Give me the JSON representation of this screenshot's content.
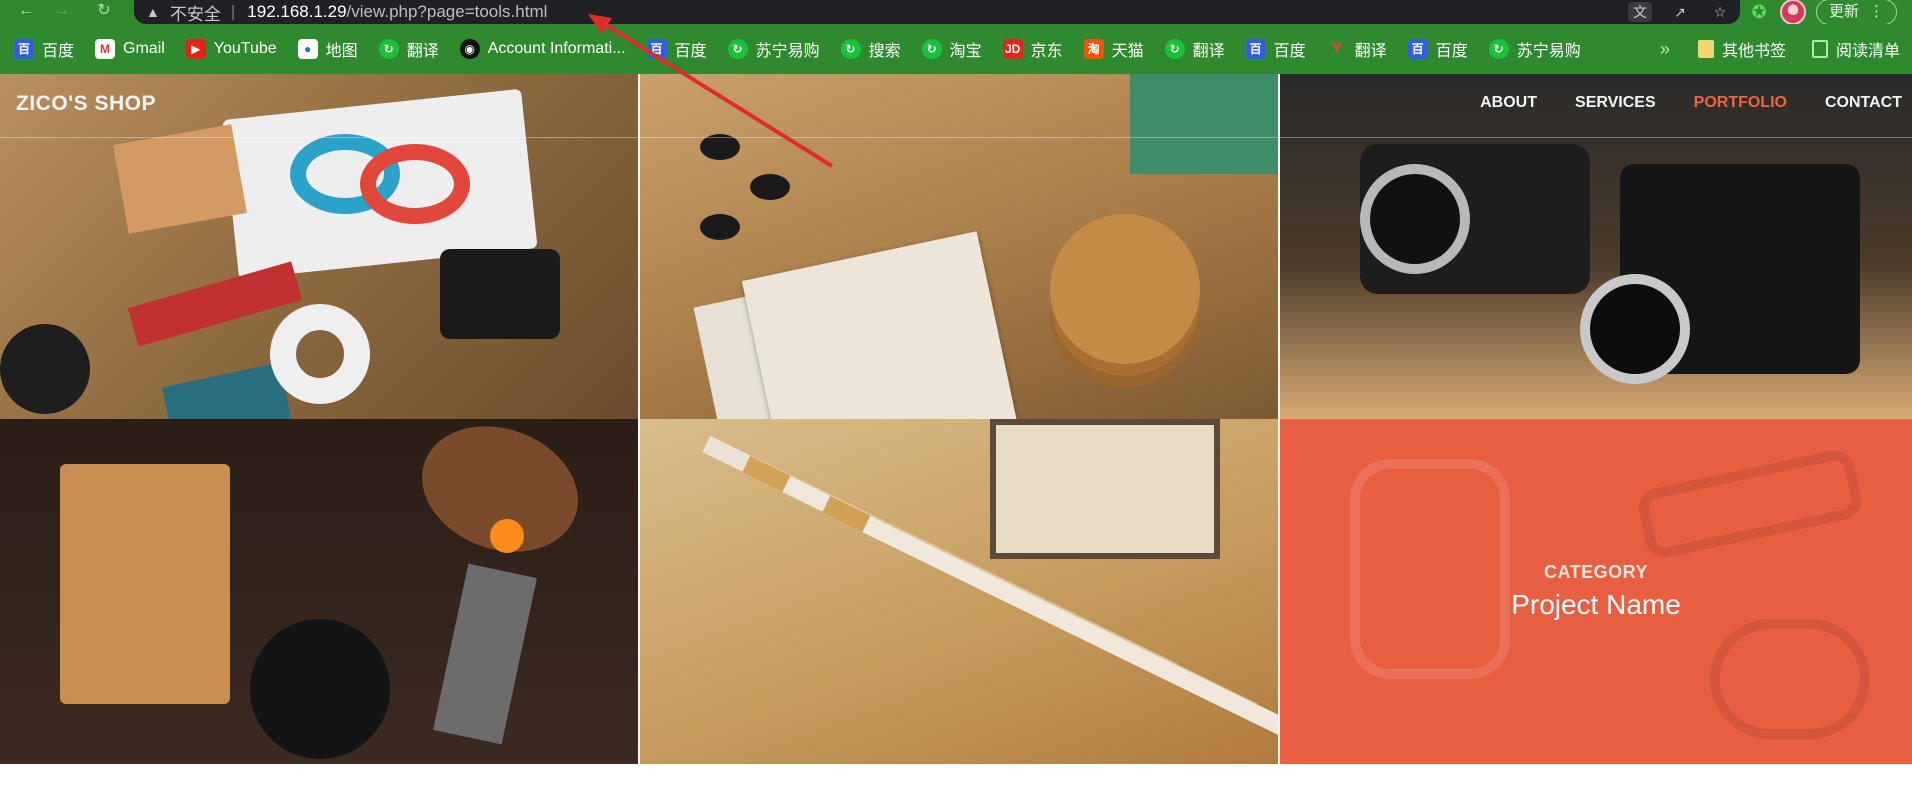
{
  "browser": {
    "omnibox": {
      "security_text": "不安全",
      "separator": "|",
      "host": "192.168.1.29",
      "path": "/view.php?page=tools.html"
    },
    "update_label": "更新",
    "bookmarks": [
      {
        "label": "百度",
        "icon": "baidu-icon"
      },
      {
        "label": "Gmail",
        "icon": "gmail-icon"
      },
      {
        "label": "YouTube",
        "icon": "youtube-icon"
      },
      {
        "label": "地图",
        "icon": "maps-icon"
      },
      {
        "label": "翻译",
        "icon": "translate-green-icon"
      },
      {
        "label": "Account Informati...",
        "icon": "account-icon"
      },
      {
        "label": "百度",
        "icon": "baidu-icon"
      },
      {
        "label": "苏宁易购",
        "icon": "suning-icon"
      },
      {
        "label": "搜索",
        "icon": "search-green-icon"
      },
      {
        "label": "淘宝",
        "icon": "taobao-icon"
      },
      {
        "label": "京东",
        "icon": "jd-icon"
      },
      {
        "label": "天猫",
        "icon": "tmall-icon"
      },
      {
        "label": "翻译",
        "icon": "translate-green-icon"
      },
      {
        "label": "百度",
        "icon": "baidu-icon"
      },
      {
        "label": "翻译",
        "icon": "youdao-icon"
      },
      {
        "label": "百度",
        "icon": "baidu-icon"
      },
      {
        "label": "苏宁易购",
        "icon": "suning-icon"
      }
    ],
    "overflow_chevron": "»",
    "other_bookmarks": "其他书签",
    "reading_list": "阅读清单"
  },
  "site": {
    "brand": "ZICO'S SHOP",
    "menu": [
      {
        "label": "ABOUT",
        "active": false
      },
      {
        "label": "SERVICES",
        "active": false
      },
      {
        "label": "PORTFOLIO",
        "active": true
      },
      {
        "label": "CONTACT",
        "active": false
      }
    ],
    "accent_color": "#f0643f",
    "portfolio": {
      "overlay_category": "CATEGORY",
      "overlay_project_name": "Project Name"
    }
  }
}
